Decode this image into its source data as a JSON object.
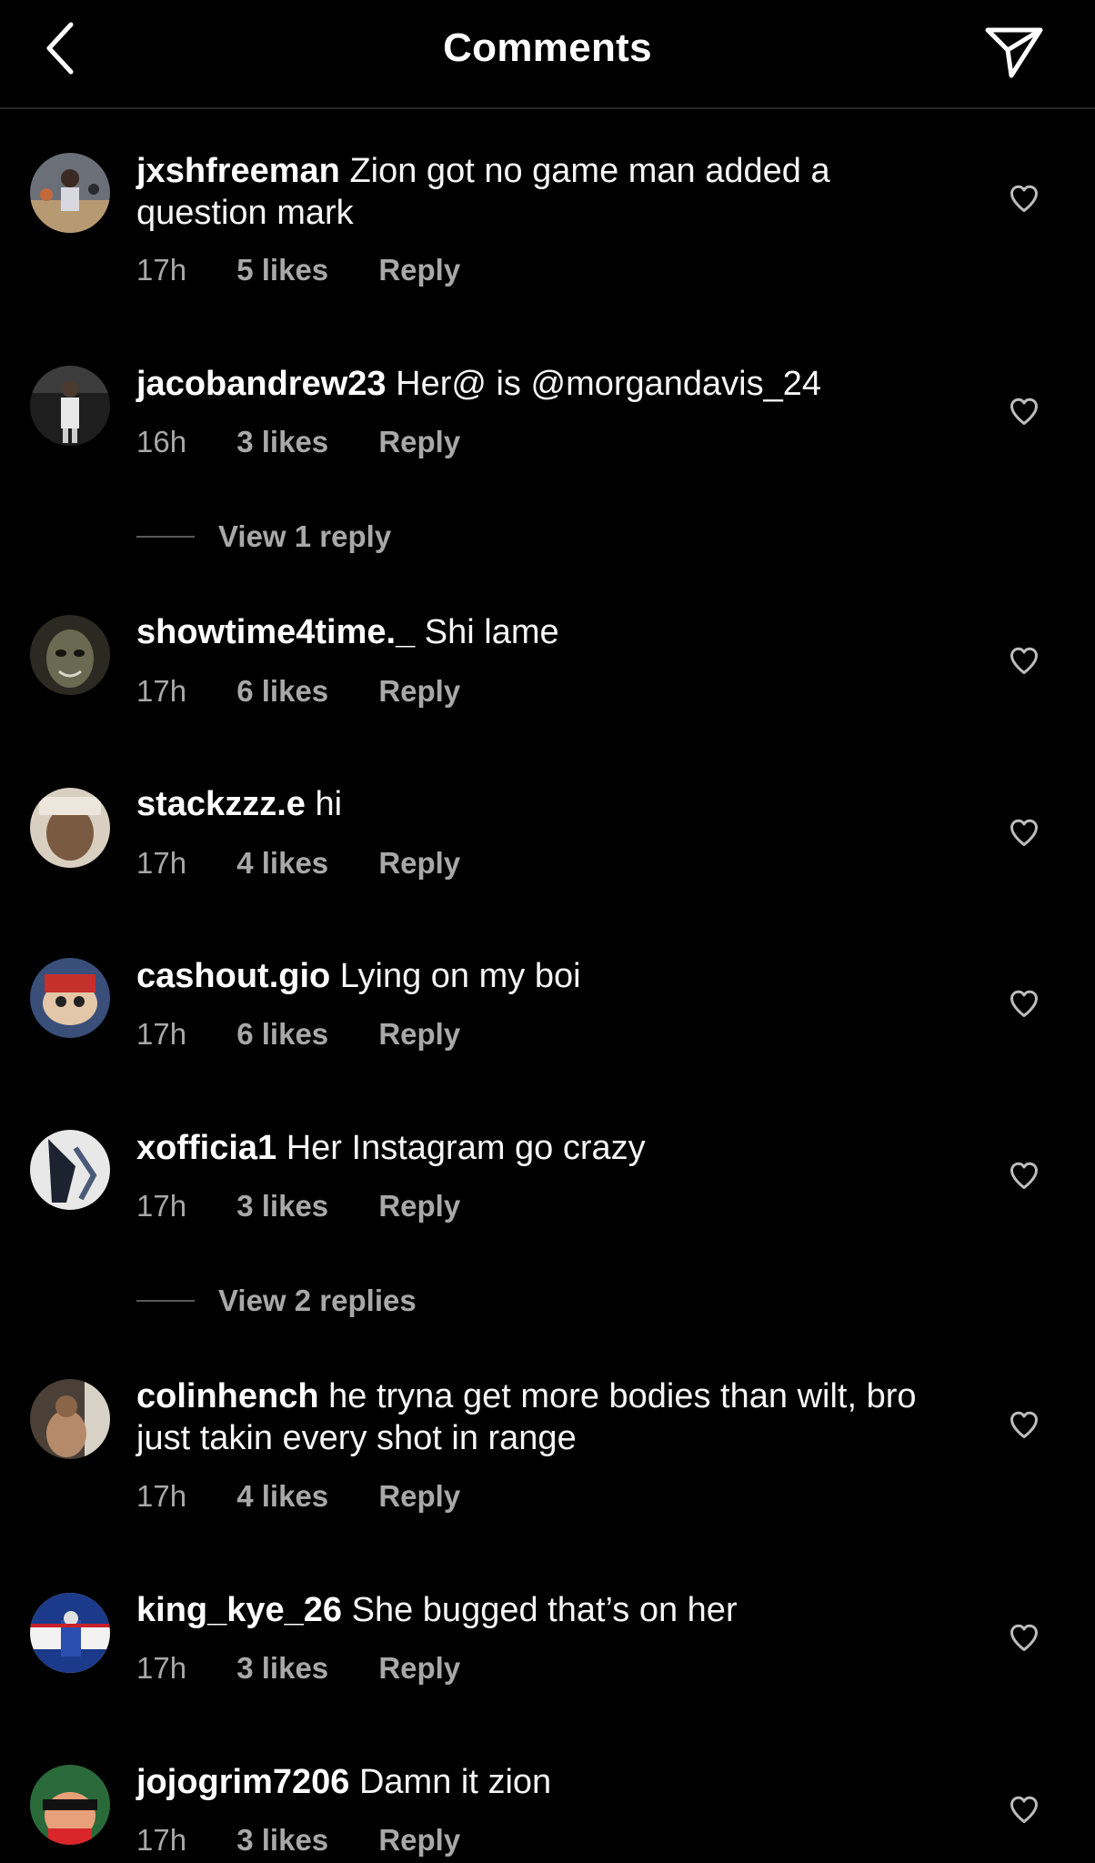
{
  "header": {
    "title": "Comments",
    "back_icon": "chevron-left-icon",
    "share_icon": "paper-plane-icon"
  },
  "colors": {
    "background": "#000000",
    "text": "#ffffff",
    "secondary_text": "#a8a8a8",
    "divider": "#262626"
  },
  "comments": [
    {
      "username": "jxshfreeman",
      "text": "Zion got no game man added a question mark",
      "time": "17h",
      "likes": "5 likes",
      "reply": "Reply"
    },
    {
      "username": "jacobandrew23",
      "text": "Her@ is @morgandavis_24",
      "time": "16h",
      "likes": "3 likes",
      "reply": "Reply",
      "view_replies": "View 1 reply"
    },
    {
      "username": "showtime4time._",
      "text": "Shi lame",
      "time": "17h",
      "likes": "6 likes",
      "reply": "Reply"
    },
    {
      "username": "stackzzz.e",
      "text": "hi",
      "time": "17h",
      "likes": "4 likes",
      "reply": "Reply"
    },
    {
      "username": "cashout.gio",
      "text": "Lying on my boi",
      "time": "17h",
      "likes": "6 likes",
      "reply": "Reply"
    },
    {
      "username": "xofficia1",
      "text": "Her Instagram go crazy",
      "time": "17h",
      "likes": "3 likes",
      "reply": "Reply",
      "view_replies": "View 2 replies"
    },
    {
      "username": "colinhench",
      "text": "he tryna get more bodies than wilt, bro just takin every shot in range",
      "time": "17h",
      "likes": "4 likes",
      "reply": "Reply"
    },
    {
      "username": "king_kye_26",
      "text": "She bugged that’s on her",
      "time": "17h",
      "likes": "3 likes",
      "reply": "Reply"
    },
    {
      "username": "jojogrim7206",
      "text": "Damn it zion",
      "time": "17h",
      "likes": "3 likes",
      "reply": "Reply"
    }
  ]
}
